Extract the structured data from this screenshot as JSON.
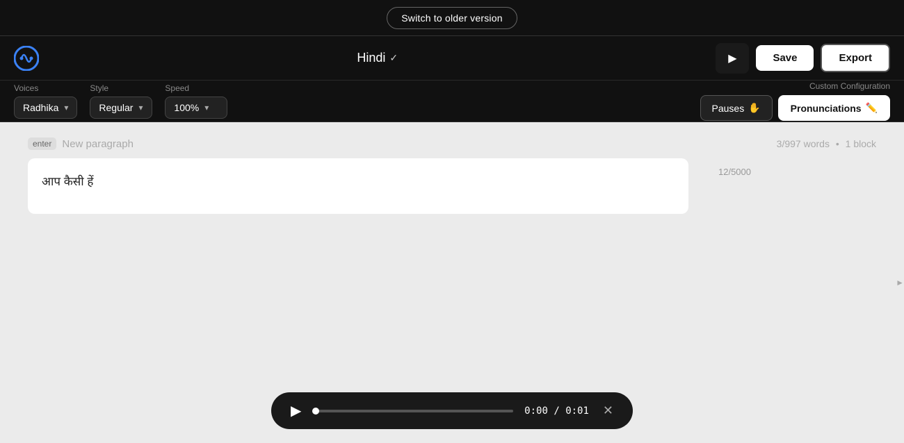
{
  "topBanner": {
    "switchVersionLabel": "Switch to older version"
  },
  "header": {
    "language": "Hindi",
    "saveLabel": "Save",
    "exportLabel": "Export"
  },
  "controls": {
    "voicesLabel": "Voices",
    "voicesValue": "Radhika",
    "styleLabel": "Style",
    "styleValue": "Regular",
    "speedLabel": "Speed",
    "speedValue": "100%",
    "customConfigLabel": "Custom Configuration",
    "pausesLabel": "Pauses",
    "pronunciationsLabel": "Pronunciations"
  },
  "editor": {
    "newParagraphPlaceholder": "New paragraph",
    "enterBadge": "enter",
    "wordCount": "3/997 words",
    "separator": "•",
    "blockCount": "1 block",
    "textContent": "आप कैसी हें",
    "charCount": "12/5000"
  },
  "player": {
    "currentTime": "0:00",
    "totalTime": "0:01",
    "separator": "/"
  }
}
